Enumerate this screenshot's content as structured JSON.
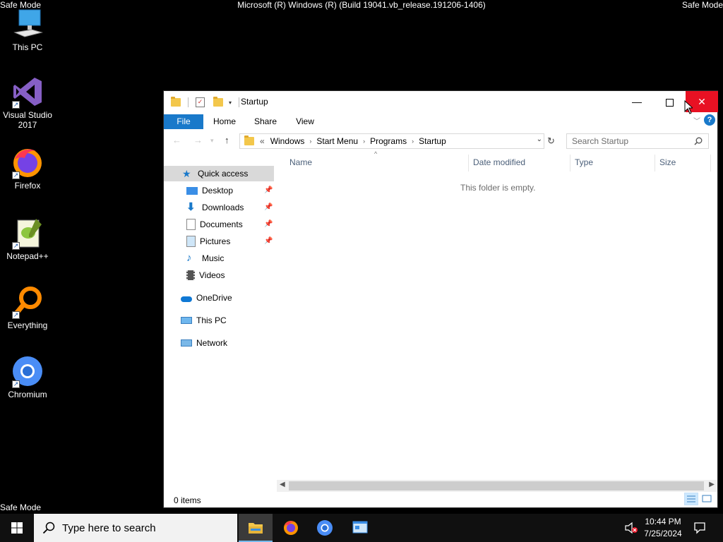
{
  "desktop": {
    "safe_mode": "Safe Mode",
    "build_text": "Microsoft (R) Windows (R) (Build 19041.vb_release.191206-1406)",
    "icons": [
      {
        "label": "This PC"
      },
      {
        "label": "Visual Studio 2017"
      },
      {
        "label": "Firefox"
      },
      {
        "label": "Notepad++"
      },
      {
        "label": "Everything"
      },
      {
        "label": "Chromium"
      }
    ]
  },
  "window": {
    "title": "Startup",
    "ribbon_tabs": {
      "file": "File",
      "home": "Home",
      "share": "Share",
      "view": "View"
    },
    "help": "?",
    "address": {
      "overflow": "«",
      "crumbs": [
        "Windows",
        "Start Menu",
        "Programs",
        "Startup"
      ]
    },
    "search_placeholder": "Search Startup",
    "nav": {
      "quick_access": "Quick access",
      "desktop": "Desktop",
      "downloads": "Downloads",
      "documents": "Documents",
      "pictures": "Pictures",
      "music": "Music",
      "videos": "Videos",
      "onedrive": "OneDrive",
      "this_pc": "This PC",
      "network": "Network"
    },
    "columns": {
      "name": "Name",
      "date_modified": "Date modified",
      "type": "Type",
      "size": "Size"
    },
    "empty_message": "This folder is empty.",
    "status": "0 items"
  },
  "taskbar": {
    "search_placeholder": "Type here to search",
    "time": "10:44 PM",
    "date": "7/25/2024"
  },
  "colors": {
    "accent": "#1979ca",
    "close": "#e81123",
    "taskbar": "#101010"
  }
}
